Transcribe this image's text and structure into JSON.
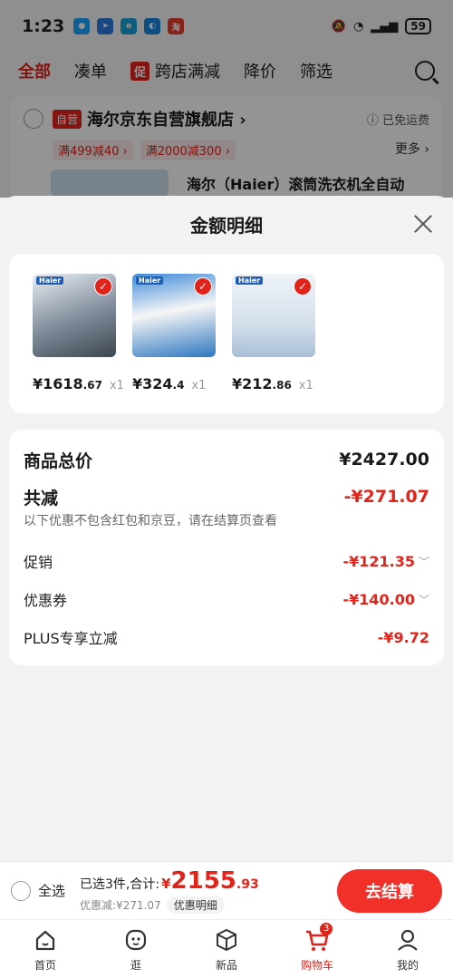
{
  "status_bar": {
    "time": "1:23",
    "battery": "59"
  },
  "cart_tabs": [
    {
      "label": "全部"
    },
    {
      "label": "凑单"
    },
    {
      "label": "跨店满减",
      "badge": "促"
    },
    {
      "label": "降价"
    },
    {
      "label": "筛选"
    }
  ],
  "store": {
    "tag": "自营",
    "name": "海尔京东自营旗舰店 ›",
    "shipping": "ⓘ 已免运费",
    "coupons": [
      "满499减40 ›",
      "满2000减300 ›"
    ],
    "more": "更多 ›",
    "product_title": "海尔（Haier）滚筒洗衣机全自动"
  },
  "sheet": {
    "title": "金额明细",
    "items": [
      {
        "price_int": "¥1618",
        "price_dec": ".67",
        "qty": "x1",
        "brand": "Haier",
        "color": "#6a7b8e"
      },
      {
        "price_int": "¥324",
        "price_dec": ".4",
        "qty": "x1",
        "brand": "Haier",
        "color": "#2f6fb0"
      },
      {
        "price_int": "¥212",
        "price_dec": ".86",
        "qty": "x1",
        "brand": "Haier",
        "color": "#dfe8f0"
      }
    ],
    "total_label": "商品总价",
    "total_value": "¥2427.00",
    "reduce_label": "共减",
    "reduce_value": "-¥271.07",
    "note": "以下优惠不包含红包和京豆，请在结算页查看",
    "promo_label": "促销",
    "promo_value": "-¥121.35",
    "coupon_label": "优惠券",
    "coupon_value": "-¥140.00",
    "plus_label": "PLUS专享立减",
    "plus_value": "-¥9.72"
  },
  "bottom": {
    "select_all": "全选",
    "selected_text": "已选3件,合计:",
    "yen": "¥",
    "total_int": "2155",
    "total_dec": ".93",
    "discount_text": "优惠减:¥271.07",
    "discount_btn": "优惠明细",
    "checkout": "去结算"
  },
  "nav": {
    "home": "首页",
    "browse": "逛",
    "new": "新品",
    "cart": "购物车",
    "cart_count": "3",
    "mine": "我的"
  },
  "colors": {
    "accent": "#e2231a",
    "checkout": "#f2302a"
  }
}
